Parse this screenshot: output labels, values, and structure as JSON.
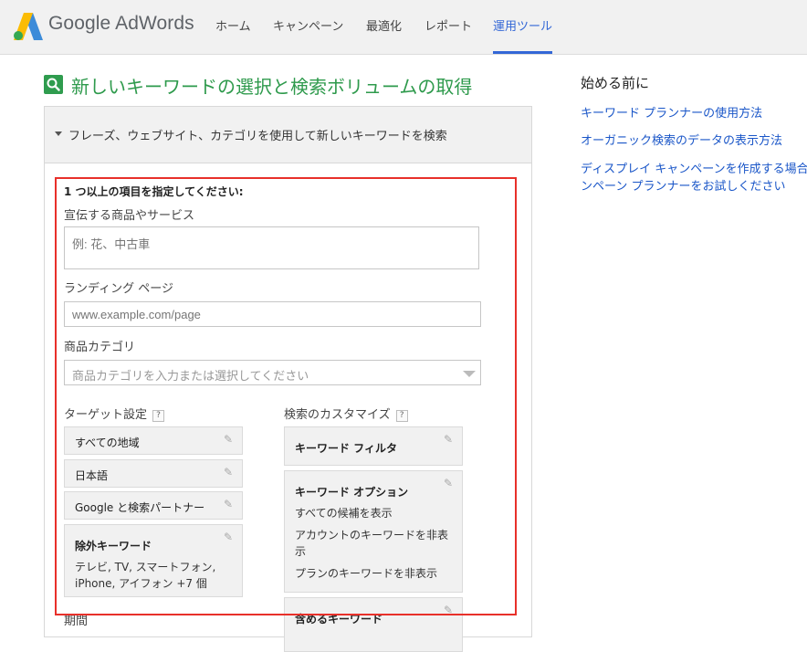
{
  "header": {
    "brand": "Google AdWords",
    "nav": [
      {
        "label": "ホーム"
      },
      {
        "label": "キャンペーン"
      },
      {
        "label": "最適化"
      },
      {
        "label": "レポート"
      },
      {
        "label": "運用ツール",
        "active": true
      }
    ],
    "accent_color": "#3367d6"
  },
  "page": {
    "title": "新しいキーワードの選択と検索ボリュームの取得",
    "title_icon": "search-icon",
    "title_color": "#2e9a4c"
  },
  "panel": {
    "head_label": "フレーズ、ウェブサイト、カテゴリを使用して新しいキーワードを検索",
    "instruction": "1 つ以上の項目を指定してください:",
    "product": {
      "label": "宣伝する商品やサービス",
      "placeholder": "例: 花、中古車"
    },
    "landing": {
      "label": "ランディング ページ",
      "placeholder": "www.example.com/page"
    },
    "category": {
      "label": "商品カテゴリ",
      "placeholder": "商品カテゴリを入力または選択してください"
    },
    "targeting": {
      "label": "ターゲット設定",
      "help": "?",
      "items": [
        {
          "label": "すべての地域"
        },
        {
          "label": "日本語"
        },
        {
          "label": "Google と検索パートナー"
        }
      ],
      "negative": {
        "title": "除外キーワード",
        "line1": "テレビ, TV, スマートフォン,",
        "line2": "iPhone, アイフォン +7 個"
      }
    },
    "customize": {
      "label": "検索のカスタマイズ",
      "help": "?",
      "filter_title": "キーワード フィルタ",
      "options": {
        "title": "キーワード オプション",
        "line1": "すべての候補を表示",
        "line2": "アカウントのキーワードを非表",
        "line3": "示",
        "line4": "プランのキーワードを非表示"
      },
      "include_title": "含めるキーワード"
    },
    "period_label": "期間"
  },
  "sidebar": {
    "title": "始める前に",
    "links": [
      {
        "label": "キーワード プランナーの使用方法"
      },
      {
        "label": "オーガニック検索のデータの表示方法"
      },
      {
        "label": "ディスプレイ キャンペーンを作成する場合"
      },
      {
        "label": "ンペーン プランナーをお試しください"
      }
    ]
  },
  "highlight_color": "#e8302a"
}
